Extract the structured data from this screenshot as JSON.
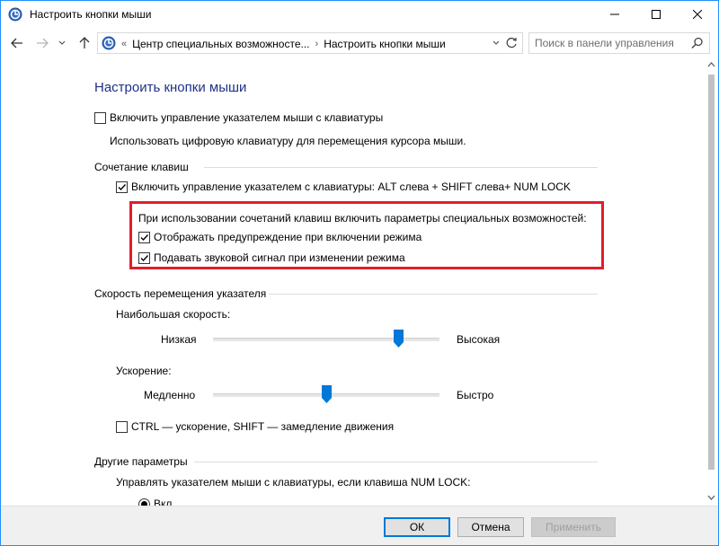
{
  "window": {
    "title": "Настроить кнопки мыши"
  },
  "nav": {
    "breadcrumbs": [
      "Центр специальных возможносте...",
      "Настроить кнопки мыши"
    ],
    "search_placeholder": "Поиск в панели управления"
  },
  "page": {
    "title": "Настроить кнопки мыши",
    "enable_keyboard_control": {
      "label": "Включить управление указателем мыши с клавиатуры",
      "checked": false
    },
    "enable_description": "Использовать цифровую клавиатуру для перемещения курсора мыши.",
    "shortcut_section": {
      "heading": "Сочетание клавиш",
      "enable_shortcut": {
        "label": "Включить управление указателем с клавиатуры: ALT слева + SHIFT слева+ NUM LOCK",
        "checked": true
      },
      "sub_heading": "При использовании сочетаний клавиш включить параметры специальных возможностей:",
      "show_warning": {
        "label": "Отображать предупреждение при включении режима",
        "checked": true
      },
      "play_sound": {
        "label": "Подавать звуковой сигнал при изменении режима",
        "checked": true
      }
    },
    "speed_section": {
      "heading": "Скорость перемещения указателя",
      "top_speed": {
        "label": "Наибольшая скорость:",
        "min_label": "Низкая",
        "max_label": "Высокая",
        "value": 0.82
      },
      "acceleration": {
        "label": "Ускорение:",
        "min_label": "Медленно",
        "max_label": "Быстро",
        "value": 0.5
      },
      "ctrl_shift": {
        "label": "CTRL — ускорение, SHIFT — замедление движения",
        "checked": false
      }
    },
    "other_section": {
      "heading": "Другие параметры",
      "numlock_label": "Управлять указателем мыши с клавиатуры, если клавиша NUM LOCK:",
      "radio_on": {
        "label": "Вкл",
        "selected": true
      }
    }
  },
  "buttons": {
    "ok": "ОК",
    "cancel": "Отмена",
    "apply": "Применить"
  },
  "colors": {
    "title_blue": "#1e3287",
    "highlight_red": "#e01e2d",
    "slider_blue": "#0078d7"
  }
}
